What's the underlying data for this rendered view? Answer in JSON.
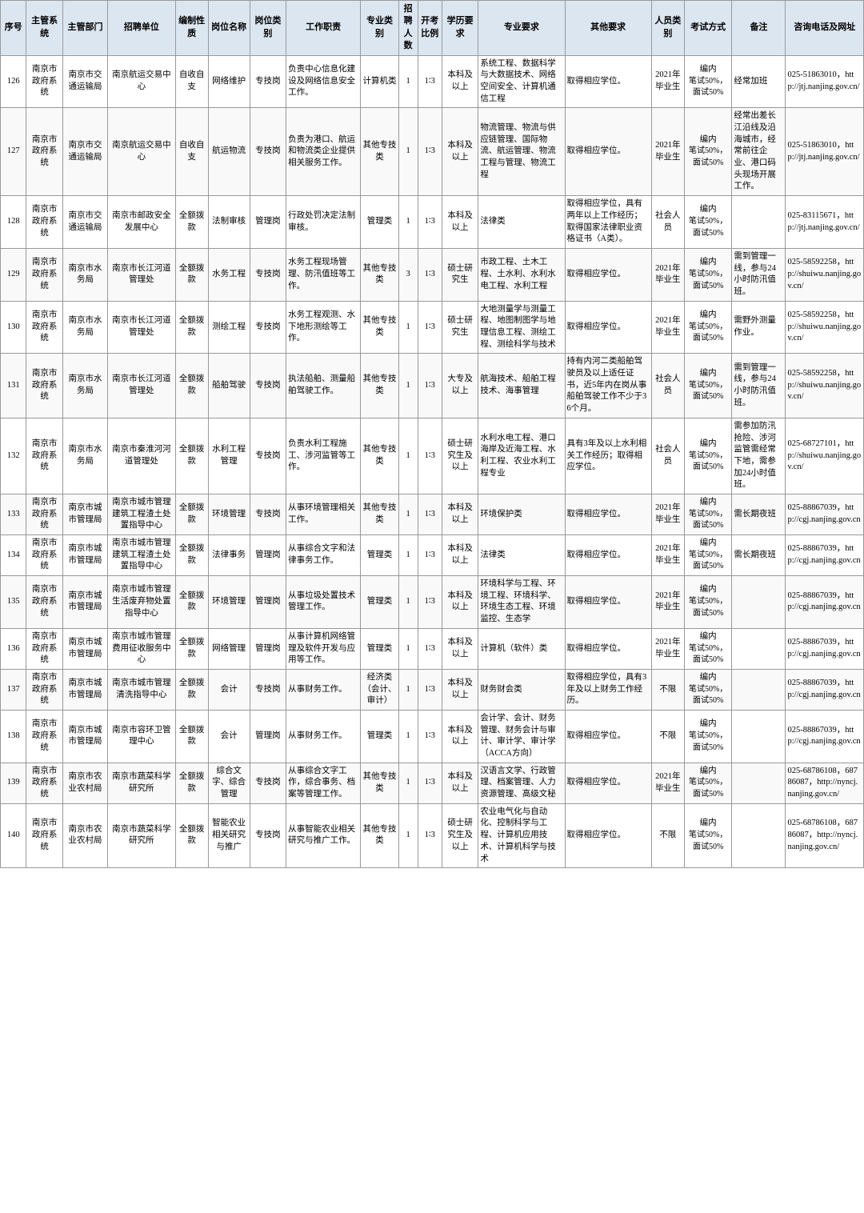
{
  "table": {
    "headers": [
      "序号",
      "主管系统",
      "主管部门",
      "招聘单位",
      "编制性质",
      "岗位名称",
      "岗位类别",
      "工作职责",
      "专业类别",
      "招聘人数",
      "开考比例",
      "学历要求",
      "专业要求",
      "其他要求",
      "人员类别",
      "考试方式",
      "备注",
      "咨询电话及网址"
    ],
    "rows": [
      {
        "no": "126",
        "system": "南京市政府系统",
        "dept": "南京市交通运输局",
        "unit": "南京航运交易中心",
        "nature": "自收自支",
        "pos": "网络维护",
        "type": "专技岗",
        "duty": "负责中心信息化建设及网络信息安全工作。",
        "cat": "计算机类",
        "num": "1",
        "ratio": "1∶3",
        "edu": "本科及以上",
        "major": "系统工程、数据科学与大数据技术、网络空间安全、计算机通信工程",
        "req": "取得相应学位。",
        "ident": "2021年毕业生",
        "exam": "编内",
        "note": "笔试50%，面试50%",
        "extra": "经常加班",
        "contact": "025-51863010，http://jtj.nanjing.gov.cn/"
      },
      {
        "no": "127",
        "system": "南京市政府系统",
        "dept": "南京市交通运输局",
        "unit": "南京航运交易中心",
        "nature": "自收自支",
        "pos": "航运物流",
        "type": "专技岗",
        "duty": "负责为港口、航运和物流类企业提供相关服务工作。",
        "cat": "其他专技类",
        "num": "1",
        "ratio": "1∶3",
        "edu": "本科及以上",
        "major": "物流管理、物流与供应链管理、国际物流、航运管理、物流工程与管理、物流工程",
        "req": "取得相应学位。",
        "ident": "2021年毕业生",
        "exam": "编内",
        "note": "笔试50%，面试50%",
        "extra": "经常出差长江沿线及沿海城市，经常前往企业、港口码头现场开展工作。",
        "contact": "025-51863010，http://jtj.nanjing.gov.cn/"
      },
      {
        "no": "128",
        "system": "南京市政府系统",
        "dept": "南京市交通运输局",
        "unit": "南京市邮政安全发展中心",
        "nature": "全额拨款",
        "pos": "法制审核",
        "type": "管理岗",
        "duty": "行政处罚决定法制审核。",
        "cat": "管理类",
        "num": "1",
        "ratio": "1∶3",
        "edu": "本科及以上",
        "major": "法律类",
        "req": "取得相应学位，具有两年以上工作经历；取得国家法律职业资格证书（A类）。",
        "ident": "社会人员",
        "exam": "编内",
        "note": "笔试50%，面试50%",
        "extra": "",
        "contact": "025-83115671，http://jtj.nanjing.gov.cn/"
      },
      {
        "no": "129",
        "system": "南京市政府系统",
        "dept": "南京市水务局",
        "unit": "南京市长江河道管理处",
        "nature": "全额拨款",
        "pos": "水务工程",
        "type": "专技岗",
        "duty": "水务工程现场管理、防汛值班等工作。",
        "cat": "其他专技类",
        "num": "3",
        "ratio": "1∶3",
        "edu": "硕士研究生",
        "major": "市政工程、土木工程、土水利、水利水电工程、水利工程",
        "req": "取得相应学位。",
        "ident": "2021年毕业生",
        "exam": "编内",
        "note": "笔试50%，面试50%",
        "extra": "需到管理一线，参与24小时防汛值班。",
        "contact": "025-58592258，http://shuiwu.nanjing.gov.cn/"
      },
      {
        "no": "130",
        "system": "南京市政府系统",
        "dept": "南京市水务局",
        "unit": "南京市长江河道管理处",
        "nature": "全额拨款",
        "pos": "测绘工程",
        "type": "专技岗",
        "duty": "水务工程观测、水下地形测绘等工作。",
        "cat": "其他专技类",
        "num": "1",
        "ratio": "1∶3",
        "edu": "硕士研究生",
        "major": "大地测量学与测量工程、地图制图学与地理信息工程、测绘工程、测绘科学与技术",
        "req": "取得相应学位。",
        "ident": "2021年毕业生",
        "exam": "编内",
        "note": "笔试50%，面试50%",
        "extra": "需野外测量作业。",
        "contact": "025-58592258，http://shuiwu.nanjing.gov.cn/"
      },
      {
        "no": "131",
        "system": "南京市政府系统",
        "dept": "南京市水务局",
        "unit": "南京市长江河道管理处",
        "nature": "全额拨款",
        "pos": "船舶驾驶",
        "type": "专技岗",
        "duty": "执法船舶、测量船舶驾驶工作。",
        "cat": "其他专技类",
        "num": "1",
        "ratio": "1∶3",
        "edu": "大专及以上",
        "major": "航海技术、船舶工程技术、海事管理",
        "req": "持有内河二类船舶驾驶员及以上适任证书，近5年内在岗从事船舶驾驶工作不少于36个月。",
        "ident": "社会人员",
        "exam": "编内",
        "note": "笔试50%，面试50%",
        "extra": "需到管理一线，参与24小时防汛值班。",
        "contact": "025-58592258，http://shuiwu.nanjing.gov.cn/"
      },
      {
        "no": "132",
        "system": "南京市政府系统",
        "dept": "南京市水务局",
        "unit": "南京市秦淮河河道管理处",
        "nature": "全额拨款",
        "pos": "水利工程管理",
        "type": "专技岗",
        "duty": "负责水利工程施工、涉河监管等工作。",
        "cat": "其他专技类",
        "num": "1",
        "ratio": "1∶3",
        "edu": "硕士研究生及以上",
        "major": "水利水电工程、港口海岸及近海工程、水利工程、农业水利工程专业",
        "req": "具有3年及以上水利相关工作经历；取得相应学位。",
        "ident": "社会人员",
        "exam": "编内",
        "note": "笔试50%，面试50%",
        "extra": "需参加防汛抢险、涉河监管需经常下地，需参加24小时值班。",
        "contact": "025-68727101，http://shuiwu.nanjing.gov.cn/"
      },
      {
        "no": "133",
        "system": "南京市政府系统",
        "dept": "南京市城市管理局",
        "unit": "南京市城市管理建筑工程渣土处置指导中心",
        "nature": "全额拨款",
        "pos": "环境管理",
        "type": "专技岗",
        "duty": "从事环境管理相关工作。",
        "cat": "其他专技类",
        "num": "1",
        "ratio": "1∶3",
        "edu": "本科及以上",
        "major": "环境保护类",
        "req": "取得相应学位。",
        "ident": "2021年毕业生",
        "exam": "编内",
        "note": "笔试50%，面试50%",
        "extra": "需长期夜班",
        "contact": "025-88867039，http://cgj.nanjing.gov.cn"
      },
      {
        "no": "134",
        "system": "南京市政府系统",
        "dept": "南京市城市管理局",
        "unit": "南京市城市管理建筑工程渣土处置指导中心",
        "nature": "全额拨款",
        "pos": "法律事务",
        "type": "管理岗",
        "duty": "从事综合文字和法律事务工作。",
        "cat": "管理类",
        "num": "1",
        "ratio": "1∶3",
        "edu": "本科及以上",
        "major": "法律类",
        "req": "取得相应学位。",
        "ident": "2021年毕业生",
        "exam": "编内",
        "note": "笔试50%，面试50%",
        "extra": "需长期夜班",
        "contact": "025-88867039，http://cgj.nanjing.gov.cn"
      },
      {
        "no": "135",
        "system": "南京市政府系统",
        "dept": "南京市城市管理局",
        "unit": "南京市城市管理生活废弃物处置指导中心",
        "nature": "全额拨款",
        "pos": "环境管理",
        "type": "管理岗",
        "duty": "从事垃圾处置技术管理工作。",
        "cat": "管理类",
        "num": "1",
        "ratio": "1∶3",
        "edu": "本科及以上",
        "major": "环境科学与工程、环境工程、环境科学、环境生态工程、环境监控、生态学",
        "req": "取得相应学位。",
        "ident": "2021年毕业生",
        "exam": "编内",
        "note": "笔试50%，面试50%",
        "extra": "",
        "contact": "025-88867039，http://cgj.nanjing.gov.cn"
      },
      {
        "no": "136",
        "system": "南京市政府系统",
        "dept": "南京市城市管理局",
        "unit": "南京市城市管理费用征收服务中心",
        "nature": "全额拨款",
        "pos": "网络管理",
        "type": "管理岗",
        "duty": "从事计算机网络管理及软件开发与应用等工作。",
        "cat": "管理类",
        "num": "1",
        "ratio": "1∶3",
        "edu": "本科及以上",
        "major": "计算机（软件）类",
        "req": "取得相应学位。",
        "ident": "2021年毕业生",
        "exam": "编内",
        "note": "笔试50%，面试50%",
        "extra": "",
        "contact": "025-88867039，http://cgj.nanjing.gov.cn"
      },
      {
        "no": "137",
        "system": "南京市政府系统",
        "dept": "南京市城市管理局",
        "unit": "南京市城市管理清洗指导中心",
        "nature": "全额拨款",
        "pos": "会计",
        "type": "专技岗",
        "duty": "从事财务工作。",
        "cat": "经济类（会计、审计）",
        "num": "1",
        "ratio": "1∶3",
        "edu": "本科及以上",
        "major": "财务财会类",
        "req": "取得相应学位，具有3年及以上财务工作经历。",
        "ident": "不限",
        "exam": "编内",
        "note": "笔试50%，面试50%",
        "extra": "",
        "contact": "025-88867039，http://cgj.nanjing.gov.cn"
      },
      {
        "no": "138",
        "system": "南京市政府系统",
        "dept": "南京市城市管理局",
        "unit": "南京市容环卫管理中心",
        "nature": "全额拨款",
        "pos": "会计",
        "type": "管理岗",
        "duty": "从事财务工作。",
        "cat": "管理类",
        "num": "1",
        "ratio": "1∶3",
        "edu": "本科及以上",
        "major": "会计学、会计、财务管理、财务会计与审计、审计学、审计学（ACCA方向）",
        "req": "取得相应学位。",
        "ident": "不限",
        "exam": "编内",
        "note": "笔试50%，面试50%",
        "extra": "",
        "contact": "025-88867039，http://cgj.nanjing.gov.cn"
      },
      {
        "no": "139",
        "system": "南京市政府系统",
        "dept": "南京市农业农村局",
        "unit": "南京市蔬菜科学研究所",
        "nature": "全额拨款",
        "pos": "综合文字、综合管理",
        "type": "专技岗",
        "duty": "从事综合文字工作，综合事务、档案等管理工作。",
        "cat": "其他专技类",
        "num": "1",
        "ratio": "1∶3",
        "edu": "本科及以上",
        "major": "汉语言文学、行政管理、档案管理、人力资源管理、高级文秘",
        "req": "取得相应学位。",
        "ident": "2021年毕业生",
        "exam": "编内",
        "note": "笔试50%，面试50%",
        "extra": "",
        "contact": "025-68786108，68786087，http://nyncj.nanjing.gov.cn/"
      },
      {
        "no": "140",
        "system": "南京市政府系统",
        "dept": "南京市农业农村局",
        "unit": "南京市蔬菜科学研究所",
        "nature": "全额拨款",
        "pos": "智能农业相关研究与推广",
        "type": "专技岗",
        "duty": "从事智能农业相关研究与推广工作。",
        "cat": "其他专技类",
        "num": "1",
        "ratio": "1∶3",
        "edu": "硕士研究生及以上",
        "major": "农业电气化与自动化、控制科学与工程、计算机应用技术、计算机科学与技术",
        "req": "取得相应学位。",
        "ident": "不限",
        "exam": "编内",
        "note": "笔试50%，面试50%",
        "extra": "",
        "contact": "025-68786108，68786087，http://nyncj.nanjing.gov.cn/"
      }
    ]
  }
}
